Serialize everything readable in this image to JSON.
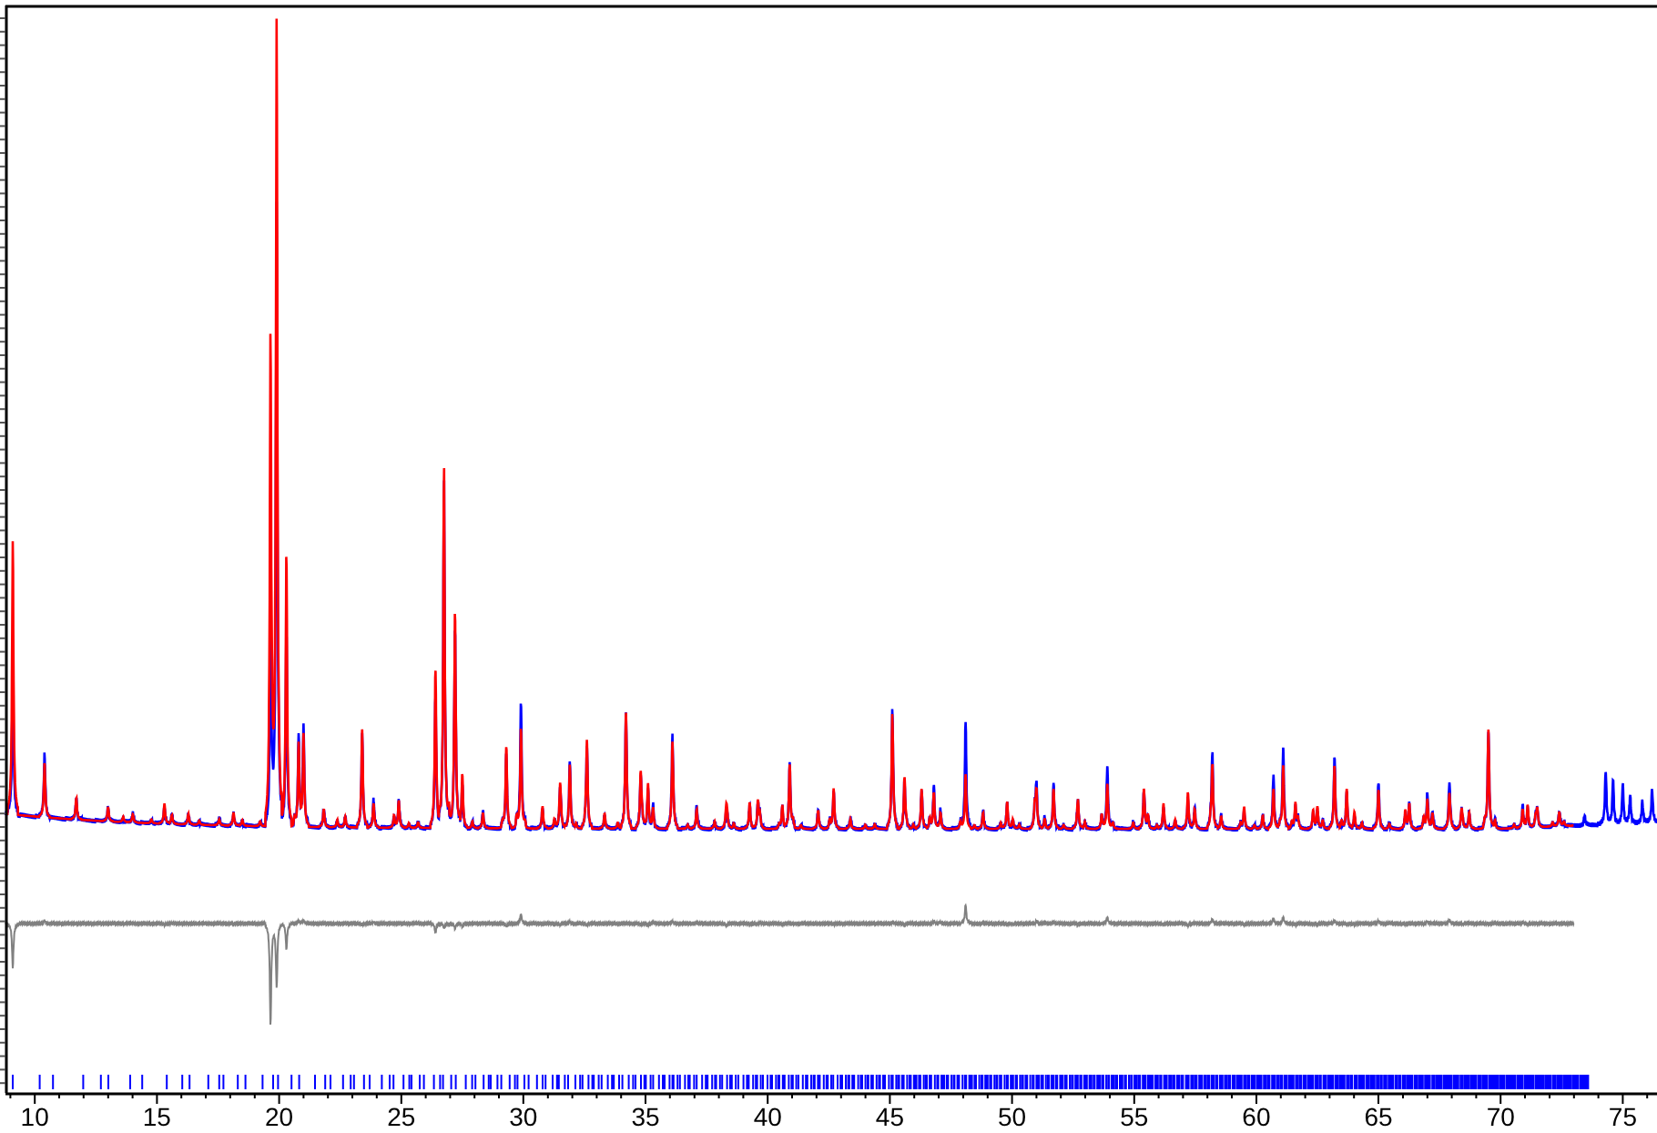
{
  "plot": {
    "x_axis": {
      "tick_labels": [
        "10",
        "15",
        "20",
        "25",
        "30",
        "35",
        "40",
        "45",
        "50",
        "55",
        "60",
        "65",
        "70",
        "75"
      ]
    }
  }
}
